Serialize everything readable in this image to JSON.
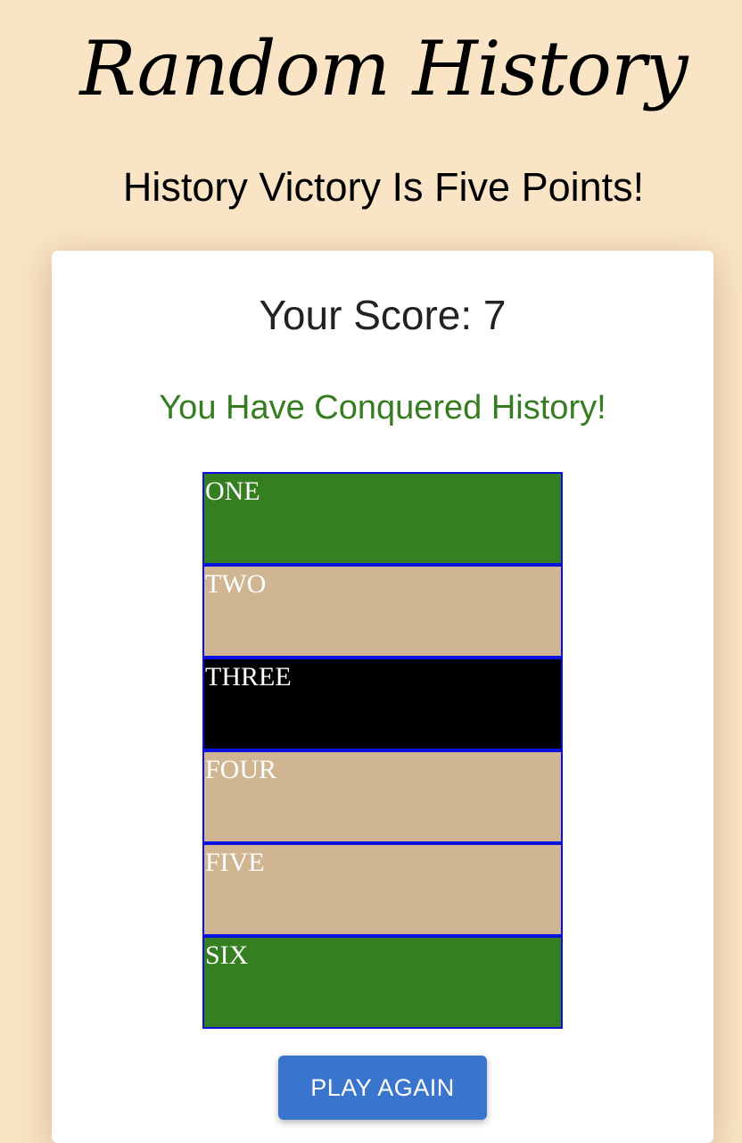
{
  "header": {
    "title": "Random History",
    "subtitle": "History Victory Is Five Points!"
  },
  "card": {
    "score_text": "Your Score: 7",
    "message": "You Have Conquered History!",
    "cells": [
      {
        "label": "ONE",
        "color": "#367f21"
      },
      {
        "label": "TWO",
        "color": "#cfb591"
      },
      {
        "label": "THREE",
        "color": "#000000"
      },
      {
        "label": "FOUR",
        "color": "#cfb591"
      },
      {
        "label": "FIVE",
        "color": "#cfb591"
      },
      {
        "label": "SIX",
        "color": "#367f21"
      }
    ],
    "play_again_label": "PLAY AGAIN"
  },
  "colors": {
    "background": "#f9e4c6",
    "success_text": "#367c21",
    "cell_border": "#0a10e0",
    "button": "#3a75cd"
  }
}
